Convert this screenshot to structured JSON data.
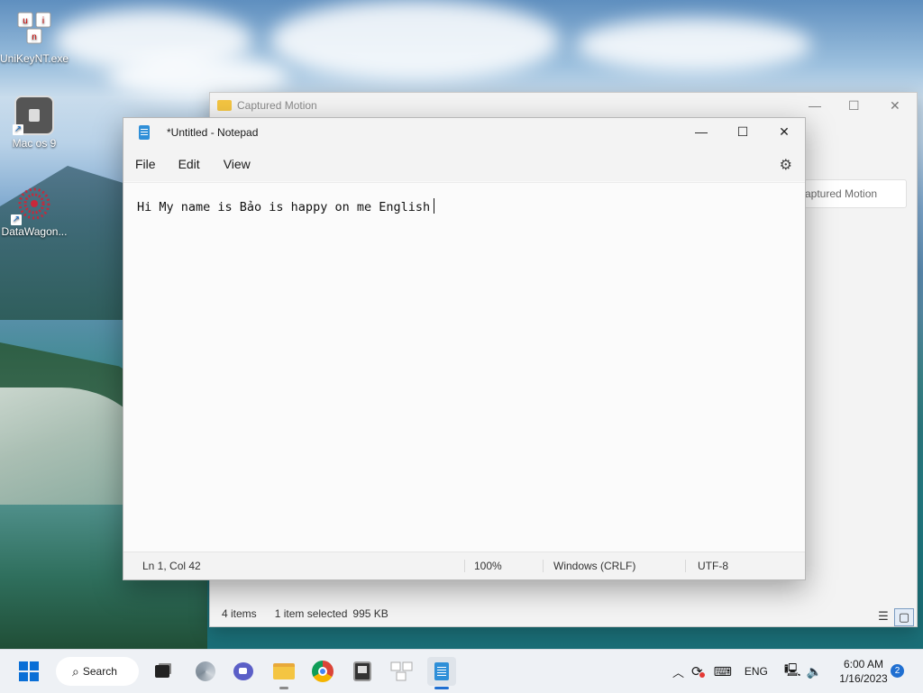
{
  "desktop": {
    "icons": [
      {
        "label": "UniKeyNT.exe",
        "icon": "unikey-icon"
      },
      {
        "label": "Mac os 9",
        "icon": "mac-os-icon"
      },
      {
        "label": "DataWagon...",
        "icon": "datawagon-icon"
      }
    ]
  },
  "explorer": {
    "title": "Captured Motion",
    "search_placeholder": "aptured Motion",
    "status": {
      "items": "4 items",
      "selected": "1 item selected",
      "size": "995 KB"
    }
  },
  "notepad": {
    "title": "*Untitled - Notepad",
    "menu": [
      "File",
      "Edit",
      "View"
    ],
    "content": "Hi My name is Bảo is happy on me English",
    "status": {
      "position": "Ln 1, Col 42",
      "zoom": "100%",
      "line_ending": "Windows (CRLF)",
      "encoding": "UTF-8"
    }
  },
  "taskbar": {
    "search_label": "Search",
    "language": "ENG",
    "time": "6:00 AM",
    "date": "1/16/2023",
    "notification_count": "2"
  }
}
